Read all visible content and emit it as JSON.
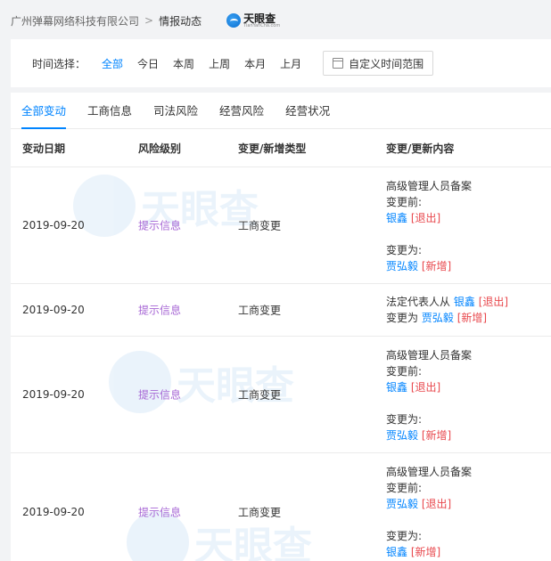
{
  "breadcrumb": {
    "company": "广州弹幕网络科技有限公司",
    "separator": ">",
    "current": "情报动态"
  },
  "logo": {
    "title": "天眼查",
    "subtitle": "TianYanCha.com"
  },
  "filter": {
    "label": "时间选择：",
    "options": [
      "全部",
      "今日",
      "本周",
      "上周",
      "本月",
      "上月"
    ],
    "active_index": 0,
    "custom_label": "自定义时间范围"
  },
  "tabs": [
    "全部变动",
    "工商信息",
    "司法风险",
    "经营风险",
    "经营状况"
  ],
  "table": {
    "headers": {
      "date": "变动日期",
      "risk": "风险级别",
      "type": "变更/新增类型",
      "content": "变更/更新内容"
    },
    "rows": [
      {
        "date": "2019-09-20",
        "risk": "提示信息",
        "type": "工商变更",
        "l1": "高级管理人员备案",
        "l2": "变更前:",
        "l3_name": "银鑫",
        "l3_tag": "[退出]",
        "l4": "变更为:",
        "l5_name": "贾弘毅",
        "l5_tag": "[新增]"
      },
      {
        "date": "2019-09-20",
        "risk": "提示信息",
        "type": "工商变更",
        "l1_prefix": "法定代表人从",
        "l1_name": "银鑫",
        "l1_tag": "[退出]",
        "l2_prefix": "变更为",
        "l2_name": "贾弘毅",
        "l2_tag": "[新增]"
      },
      {
        "date": "2019-09-20",
        "risk": "提示信息",
        "type": "工商变更",
        "l1": "高级管理人员备案",
        "l2": "变更前:",
        "l3_name": "银鑫",
        "l3_tag": "[退出]",
        "l4": "变更为:",
        "l5_name": "贾弘毅",
        "l5_tag": "[新增]"
      },
      {
        "date": "2019-09-20",
        "risk": "提示信息",
        "type": "工商变更",
        "l1": "高级管理人员备案",
        "l2": "变更前:",
        "l3_name": "贾弘毅",
        "l3_tag": "[退出]",
        "l4": "变更为:",
        "l5_name": "银鑫",
        "l5_tag": "[新增]"
      }
    ]
  },
  "colors": {
    "accent": "#0084ff",
    "risk": "#a767d5",
    "tag": "#e8484d",
    "watermark": "#0a6fd1"
  },
  "icons": {
    "calendar": "calendar-icon",
    "logo": "tianyancha-logo-icon"
  }
}
